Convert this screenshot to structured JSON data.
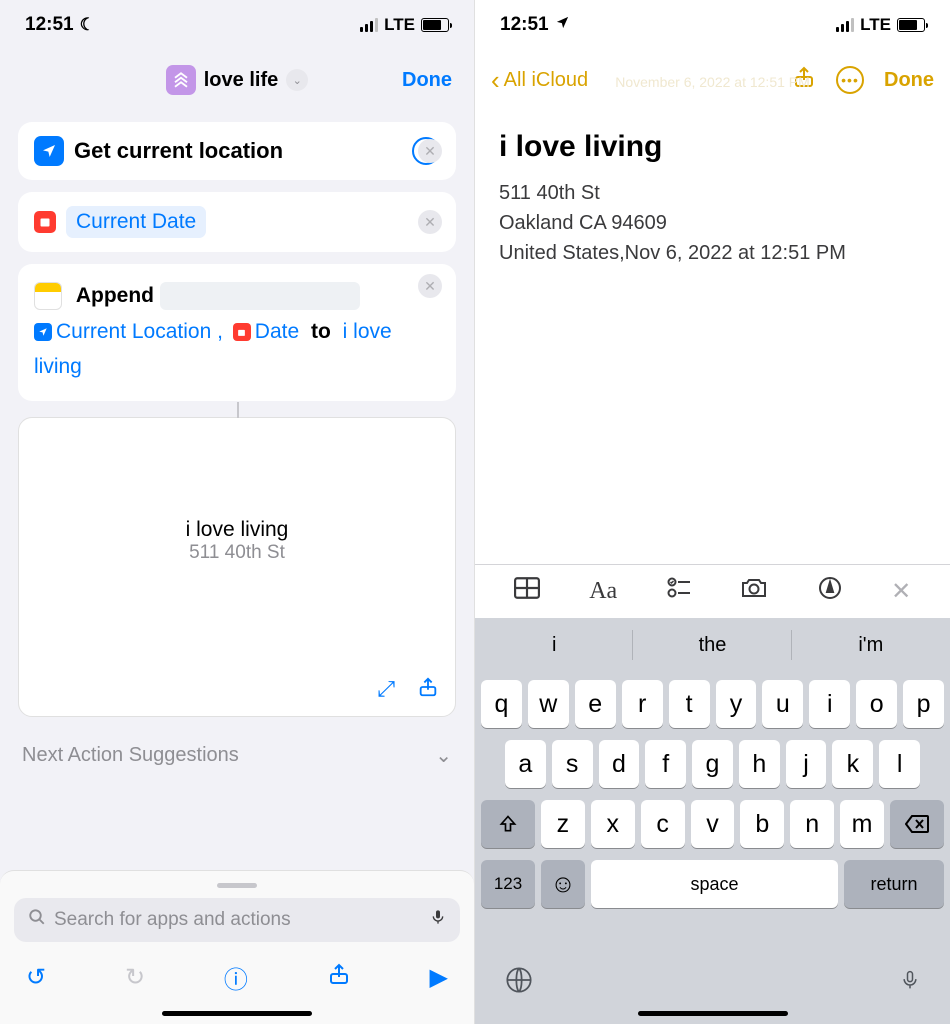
{
  "left": {
    "status": {
      "time": "12:51",
      "network": "LTE"
    },
    "header": {
      "shortcut_name": "love life",
      "done": "Done"
    },
    "actions": {
      "get_location": "Get current location",
      "current_date": "Current Date",
      "append": {
        "word": "Append",
        "var1": "Current Location",
        "comma": ",",
        "var2": "Date",
        "to": "to",
        "target": "i love living"
      }
    },
    "preview": {
      "title": "i love living",
      "subtitle": "511 40th St"
    },
    "suggestions_label": "Next Action Suggestions",
    "search_placeholder": "Search for apps and actions"
  },
  "right": {
    "status": {
      "time": "12:51",
      "network": "LTE"
    },
    "nav": {
      "back": "All iCloud",
      "done": "Done"
    },
    "faint_date": "November 6, 2022 at 12:51 PM",
    "note": {
      "title": "i love living",
      "line1": "511 40th St",
      "line2": "Oakland CA 94609",
      "line3": "United States,Nov 6, 2022 at 12:51 PM"
    },
    "suggestions": [
      "i",
      "the",
      "i'm"
    ],
    "keys": {
      "row1": [
        "q",
        "w",
        "e",
        "r",
        "t",
        "y",
        "u",
        "i",
        "o",
        "p"
      ],
      "row2": [
        "a",
        "s",
        "d",
        "f",
        "g",
        "h",
        "j",
        "k",
        "l"
      ],
      "row3": [
        "z",
        "x",
        "c",
        "v",
        "b",
        "n",
        "m"
      ],
      "num": "123",
      "space": "space",
      "return": "return"
    }
  }
}
